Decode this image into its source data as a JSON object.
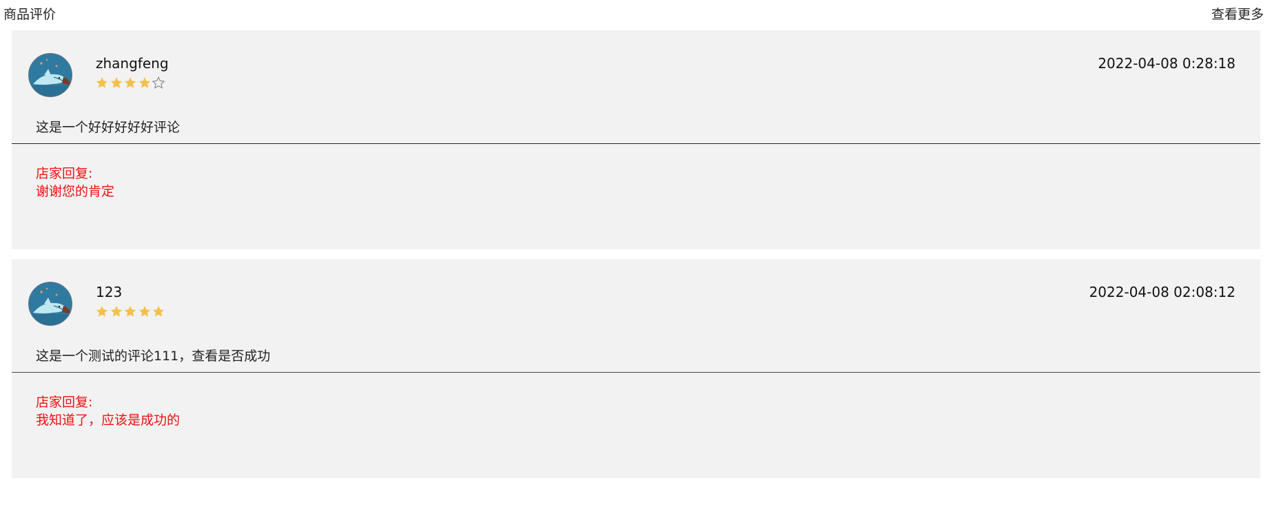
{
  "header": {
    "title": "商品评价",
    "more_label": "查看更多"
  },
  "colors": {
    "card_background": "#f2f2f2",
    "star_filled": "#f5c04a",
    "star_empty_outline": "#888888",
    "reply_text": "#f01010"
  },
  "reviews": [
    {
      "username": "zhangfeng",
      "rating": 4,
      "max_rating": 5,
      "date": "2022-04-08 0:28:18",
      "content": "这是一个好好好好好评论",
      "reply_label": "店家回复:",
      "reply_text": "谢谢您的肯定"
    },
    {
      "username": "123",
      "rating": 5,
      "max_rating": 5,
      "date": "2022-04-08 02:08:12",
      "content": "这是一个测试的评论111，查看是否成功",
      "reply_label": "店家回复:",
      "reply_text": "我知道了，应该是成功的"
    }
  ]
}
